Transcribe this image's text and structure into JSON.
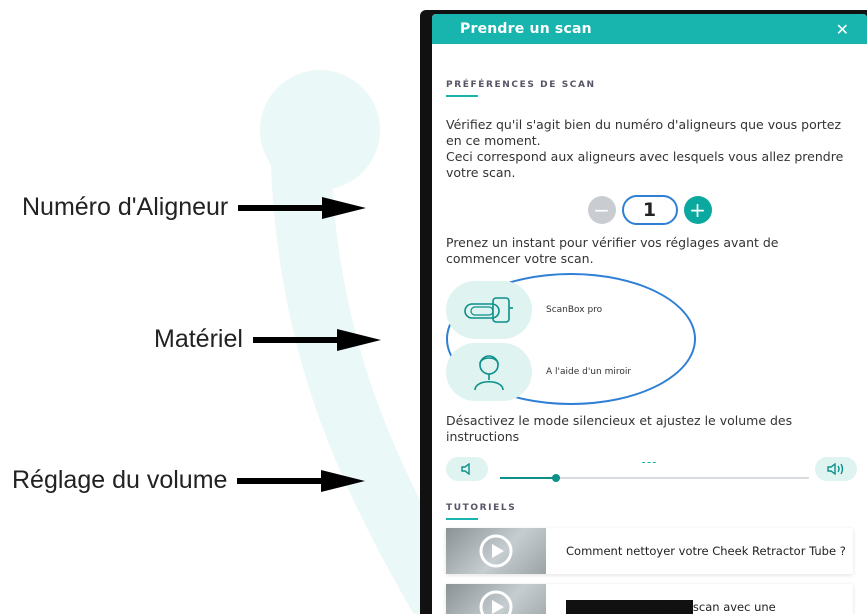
{
  "annotations": [
    {
      "label": "Numéro d'Aligneur"
    },
    {
      "label": "Matériel"
    },
    {
      "label": "Réglage du volume"
    }
  ],
  "header": {
    "title": "Prendre un scan",
    "close_icon": "close-icon"
  },
  "preferences": {
    "section_title": "PRÉFÉRENCES DE SCAN",
    "aligner_instructions": "Vérifiez qu'il s'agit bien du numéro d'aligneurs que vous portez en ce moment.",
    "aligner_instructions_2": "Ceci correspond aux aligneurs avec lesquels vous allez prendre votre scan.",
    "aligner_number": "1",
    "minus_label": "−",
    "plus_label": "+",
    "settings_instruction": "Prenez un instant pour vérifier vos réglages avant de commencer votre scan.",
    "materials": [
      {
        "label": "ScanBox pro",
        "icon": "scanbox-icon"
      },
      {
        "label": "A l'aide d'un miroir",
        "icon": "person-mirror-icon"
      }
    ],
    "volume_instruction": "Désactivez le mode silencieux et ajustez le volume des instructions",
    "volume": {
      "value_text": "---",
      "level": 0.18,
      "down_icon": "volume-down-icon",
      "up_icon": "volume-up-icon"
    }
  },
  "tutorials": {
    "section_title": "TUTORIELS",
    "items": [
      {
        "title": "Comment nettoyer votre Cheek Retractor Tube ?",
        "icon": "play-icon"
      },
      {
        "title_tail": "scan avec une",
        "icon": "play-icon"
      }
    ]
  },
  "colors": {
    "accent": "#18b5ae",
    "highlight": "#2f7fd6"
  }
}
